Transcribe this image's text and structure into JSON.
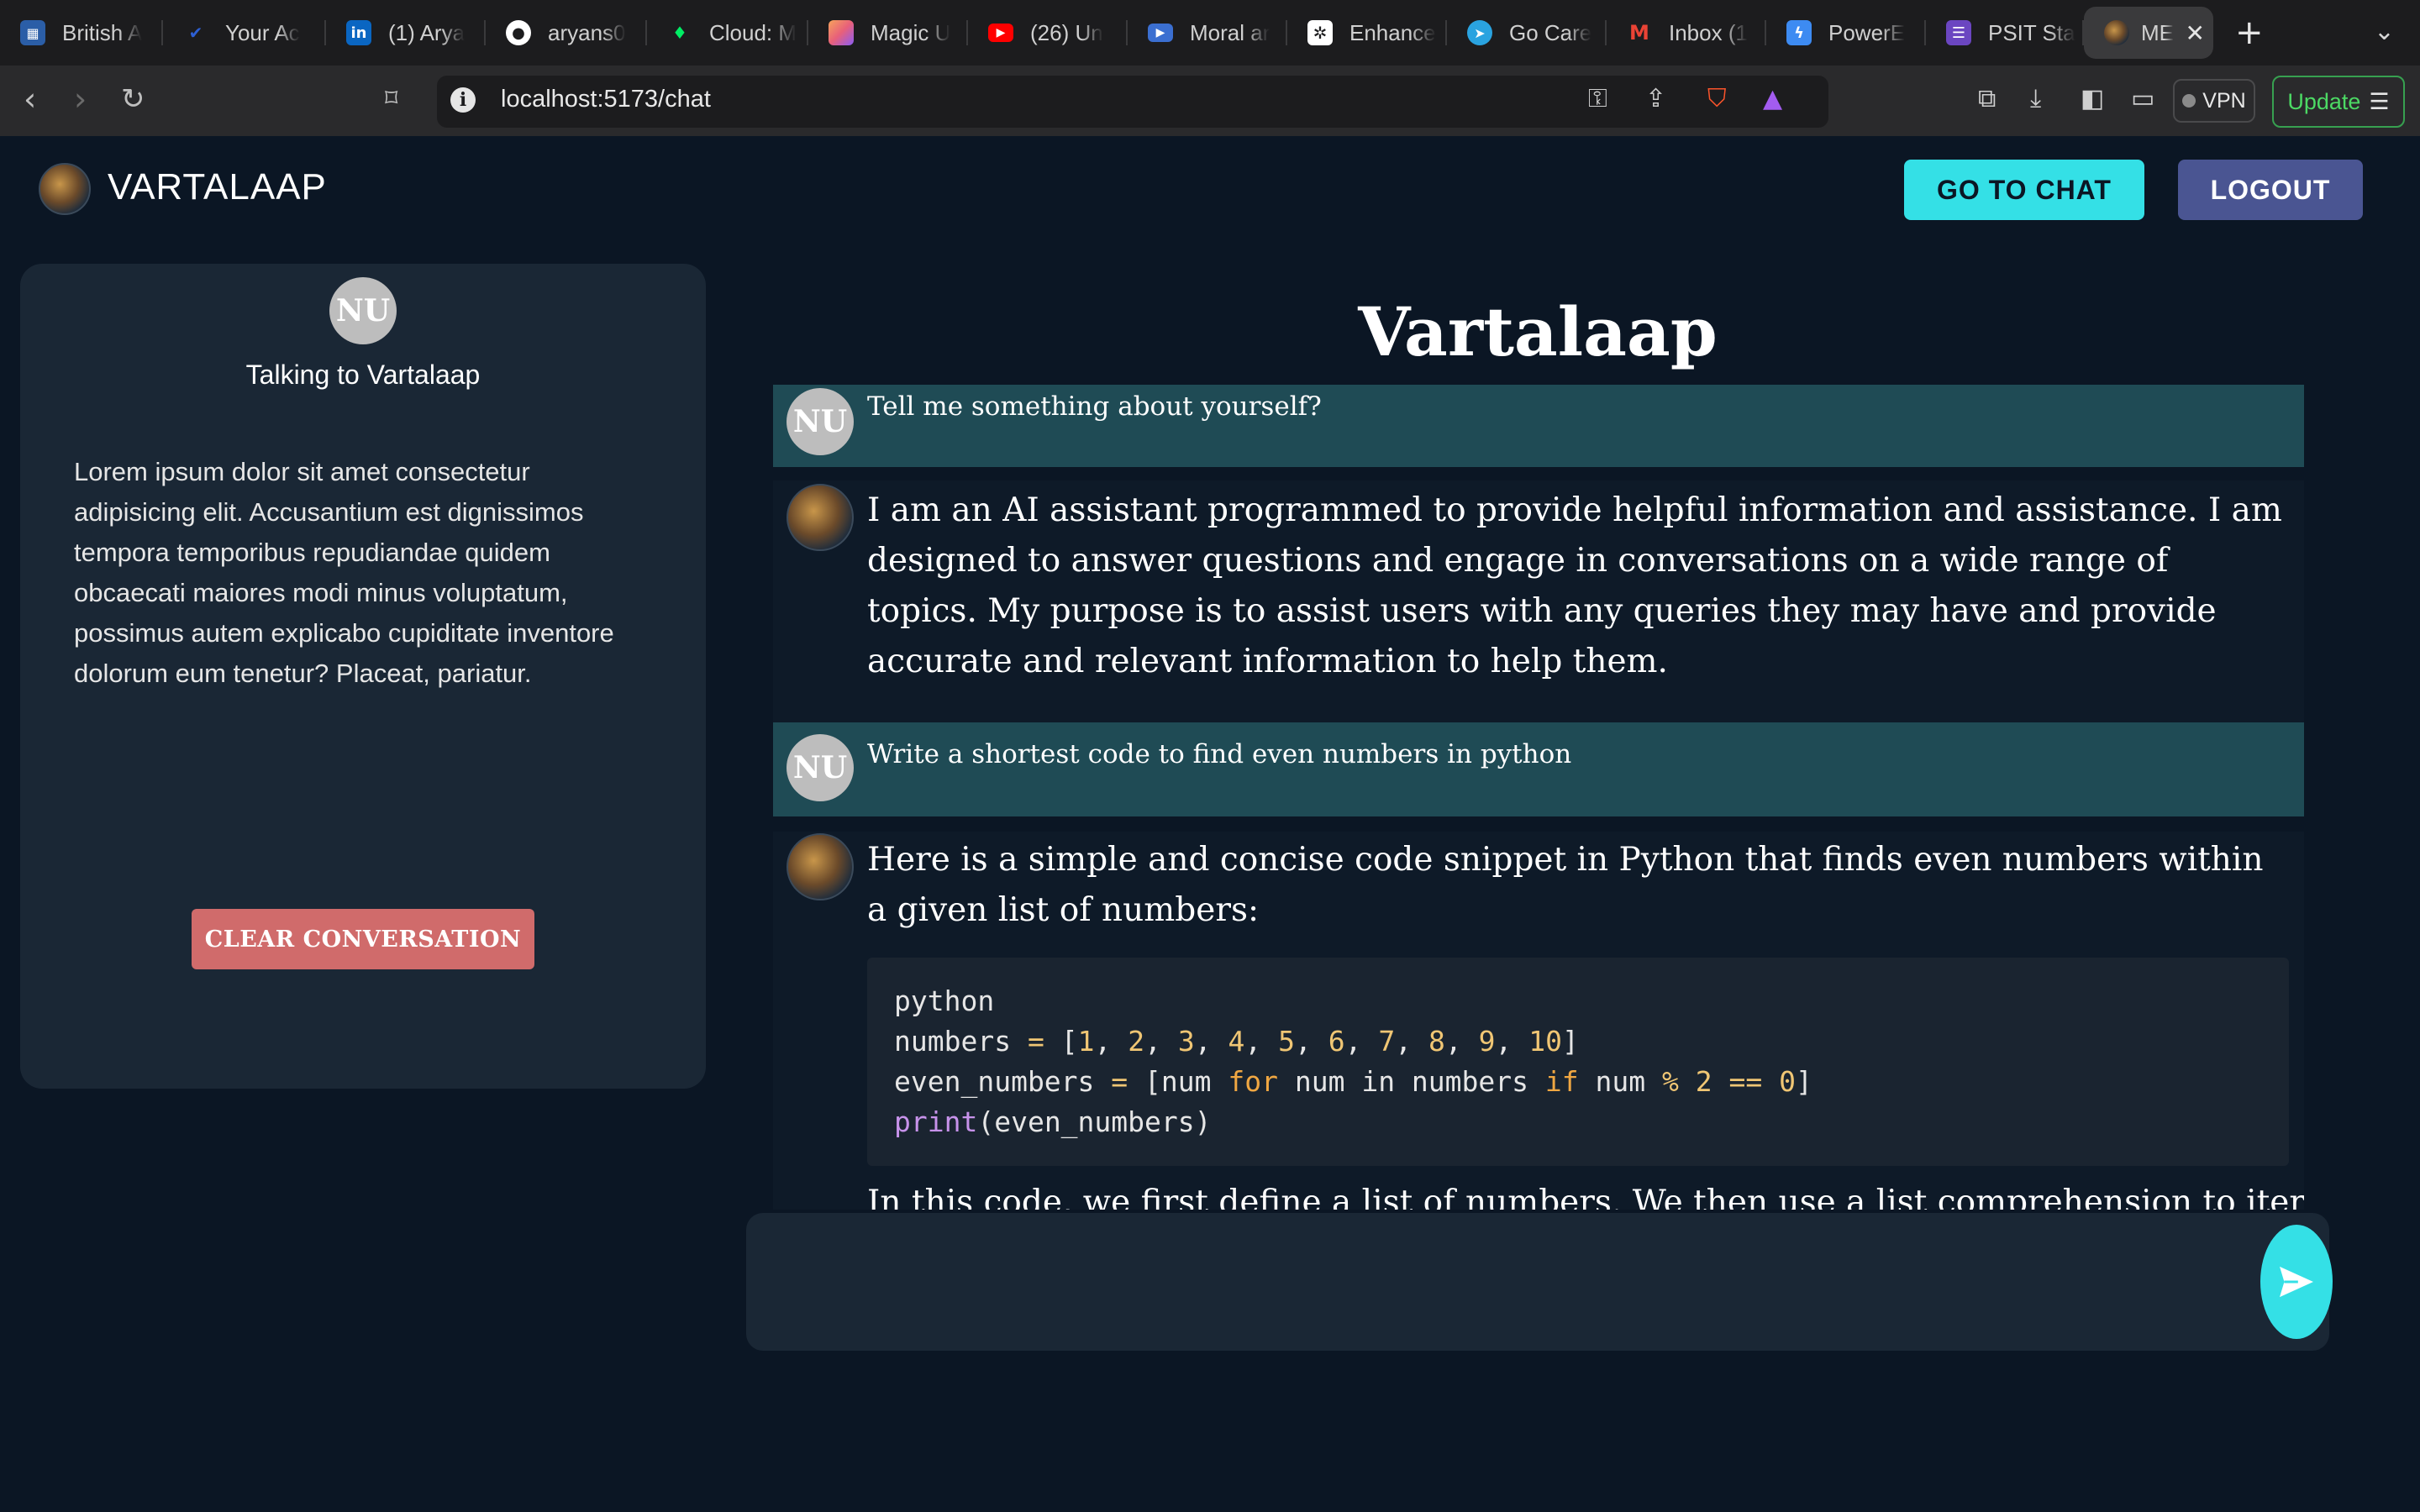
{
  "browser": {
    "tabs": [
      {
        "title": "British A",
        "icon": "british-airways-icon",
        "color": "#2b5ea7"
      },
      {
        "title": "Your Ac",
        "icon": "check-shield-icon",
        "color": "#2d5fd3"
      },
      {
        "title": "(1) Arya",
        "icon": "linkedin-icon",
        "color": "#0a66c2"
      },
      {
        "title": "aryans0",
        "icon": "github-icon",
        "color": "#ffffff"
      },
      {
        "title": "Cloud: M",
        "icon": "leaf-icon",
        "color": "#00ed64"
      },
      {
        "title": "Magic U",
        "icon": "magic-icon",
        "color": "#e8607a"
      },
      {
        "title": "(26) Un",
        "icon": "youtube-icon",
        "color": "#ff0000"
      },
      {
        "title": "Moral ar",
        "icon": "video-icon",
        "color": "#3b6fd1"
      },
      {
        "title": "Enhance",
        "icon": "openai-icon",
        "color": "#ffffff"
      },
      {
        "title": "Go Care",
        "icon": "telegram-icon",
        "color": "#2aa3e0"
      },
      {
        "title": "Inbox (1",
        "icon": "gmail-icon",
        "color": "#ea4335"
      },
      {
        "title": "PowerE",
        "icon": "powere-icon",
        "color": "#3d8bf2"
      },
      {
        "title": "PSIT Sta",
        "icon": "list-icon",
        "color": "#6b46c1"
      },
      {
        "title": "MEF",
        "icon": "app-avatar-icon",
        "color": "#c8964a"
      }
    ],
    "url": "localhost:5173/chat",
    "vpn_label": "VPN",
    "update_label": "Update"
  },
  "header": {
    "app_name": "VARTALAAP",
    "go_chat_label": "GO TO CHAT",
    "logout_label": "LOGOUT"
  },
  "sidebar": {
    "avatar_initials": "NU",
    "title": "Talking to Vartalaap",
    "description": "Lorem ipsum dolor sit amet consectetur adipisicing elit. Accusantium est dignissimos tempora temporibus repudiandae quidem obcaecati maiores modi minus voluptatum, possimus autem explicabo cupiditate inventore dolorum eum tenetur? Placeat, pariatur.",
    "clear_label": "CLEAR CONVERSATION"
  },
  "chat": {
    "title": "Vartalaap",
    "messages": [
      {
        "role": "user",
        "initials": "NU",
        "text": "Tell me something about yourself?"
      },
      {
        "role": "assistant",
        "text": "I am an AI assistant programmed to provide helpful information and assistance. I am designed to answer questions and engage in conversations on a wide range of topics. My purpose is to assist users with any queries they may have and provide accurate and relevant information to help them."
      },
      {
        "role": "user",
        "initials": "NU",
        "text": "Write a shortest code to find even numbers in python"
      },
      {
        "role": "assistant",
        "text": "Here is a simple and concise code snippet in Python that finds even numbers within a given list of numbers:",
        "code_lines": [
          "python",
          "numbers = [1, 2, 3, 4, 5, 6, 7, 8, 9, 10]",
          "even_numbers = [num for num in numbers if num % 2 == 0]",
          "print(even_numbers)"
        ],
        "continuation": "In this code, we first define a list of numbers. We then use a list comprehension to iterate"
      }
    ],
    "input_placeholder": ""
  },
  "colors": {
    "background": "#0b1624",
    "accent": "#34e0e6",
    "logout": "#4a5592",
    "clear": "#d06b6b",
    "user_bubble": "#1f4b55"
  }
}
